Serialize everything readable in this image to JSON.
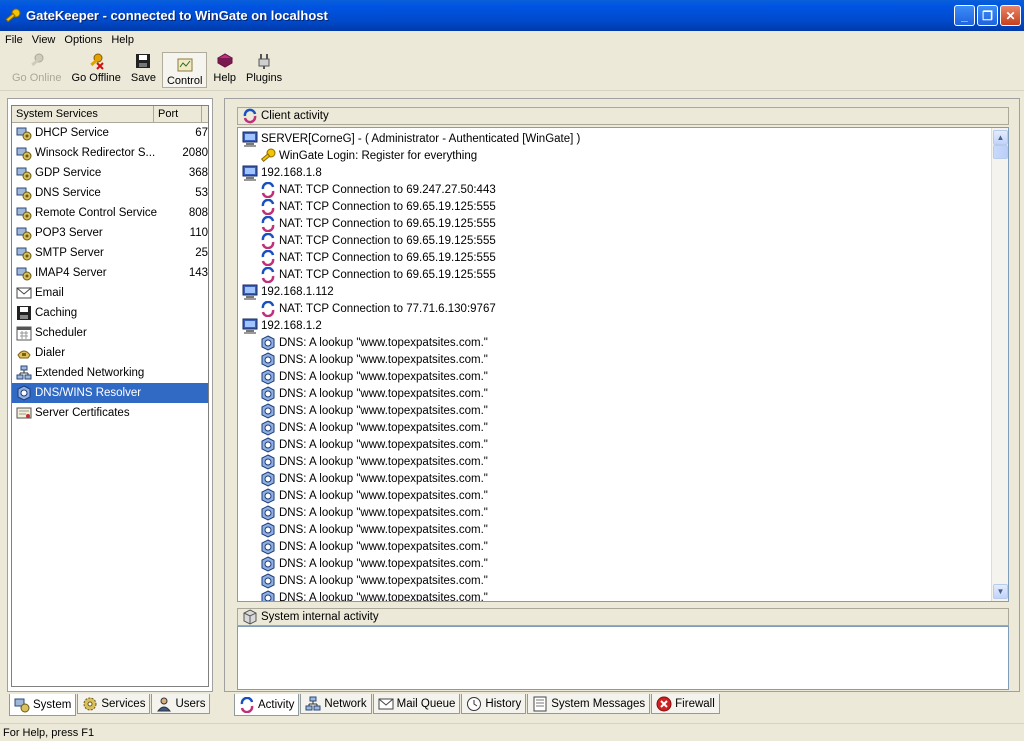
{
  "window": {
    "title": "GateKeeper - connected to WinGate on localhost",
    "minimize": "_",
    "maximize": "❐",
    "close": "✕"
  },
  "menu": [
    "File",
    "View",
    "Options",
    "Help"
  ],
  "toolbar": [
    {
      "label": "Go Online",
      "icon": "key-icon",
      "disabled": true
    },
    {
      "label": "Go Offline",
      "icon": "key-disconnect-icon"
    },
    {
      "label": "Save",
      "icon": "floppy-disk-icon"
    },
    {
      "label": "Control",
      "icon": "control-panel-icon",
      "pressed": true
    },
    {
      "label": "Help",
      "icon": "book-icon"
    },
    {
      "label": "Plugins",
      "icon": "plug-icon"
    }
  ],
  "left_panel": {
    "columns": [
      "System Services",
      "Port"
    ],
    "items": [
      {
        "name": "DHCP Service",
        "port": "67",
        "icon": "service-icon"
      },
      {
        "name": "Winsock Redirector S...",
        "port": "2080",
        "icon": "service-icon"
      },
      {
        "name": "GDP Service",
        "port": "368",
        "icon": "service-icon"
      },
      {
        "name": "DNS Service",
        "port": "53",
        "icon": "service-icon"
      },
      {
        "name": "Remote Control Service",
        "port": "808",
        "icon": "service-icon"
      },
      {
        "name": "POP3 Server",
        "port": "110",
        "icon": "service-icon"
      },
      {
        "name": "SMTP Server",
        "port": "25",
        "icon": "service-icon"
      },
      {
        "name": "IMAP4 Server",
        "port": "143",
        "icon": "service-icon"
      },
      {
        "name": "Email",
        "port": "",
        "icon": "envelope-icon"
      },
      {
        "name": "Caching",
        "port": "",
        "icon": "disk-icon"
      },
      {
        "name": "Scheduler",
        "port": "",
        "icon": "calendar-icon"
      },
      {
        "name": "Dialer",
        "port": "",
        "icon": "phone-icon"
      },
      {
        "name": "Extended Networking",
        "port": "",
        "icon": "network-icon"
      },
      {
        "name": "DNS/WINS Resolver",
        "port": "",
        "icon": "resolver-icon",
        "selected": true
      },
      {
        "name": "Server Certificates",
        "port": "",
        "icon": "certificate-icon"
      }
    ],
    "tabs": [
      {
        "label": "System",
        "icon": "system-icon",
        "active": true
      },
      {
        "label": "Services",
        "icon": "gear-icon"
      },
      {
        "label": "Users",
        "icon": "user-icon"
      }
    ]
  },
  "right_panel": {
    "client_activity_title": "Client activity",
    "rows": [
      {
        "level": 0,
        "icon": "computer-icon",
        "text": "SERVER[CorneG]  -  ( Administrator  -  Authenticated [WinGate] )"
      },
      {
        "level": 1,
        "icon": "key-icon",
        "text": "WinGate Login: Register for everything"
      },
      {
        "level": 0,
        "icon": "computer-icon",
        "text": "192.168.1.8"
      },
      {
        "level": 1,
        "icon": "nat-icon",
        "text": "NAT: TCP Connection to 69.247.27.50:443"
      },
      {
        "level": 1,
        "icon": "nat-icon",
        "text": "NAT: TCP Connection to 69.65.19.125:555"
      },
      {
        "level": 1,
        "icon": "nat-icon",
        "text": "NAT: TCP Connection to 69.65.19.125:555"
      },
      {
        "level": 1,
        "icon": "nat-icon",
        "text": "NAT: TCP Connection to 69.65.19.125:555"
      },
      {
        "level": 1,
        "icon": "nat-icon",
        "text": "NAT: TCP Connection to 69.65.19.125:555"
      },
      {
        "level": 1,
        "icon": "nat-icon",
        "text": "NAT: TCP Connection to 69.65.19.125:555"
      },
      {
        "level": 0,
        "icon": "computer-icon",
        "text": "192.168.1.112"
      },
      {
        "level": 1,
        "icon": "nat-icon",
        "text": "NAT: TCP Connection to 77.71.6.130:9767"
      },
      {
        "level": 0,
        "icon": "computer-icon",
        "text": "192.168.1.2"
      },
      {
        "level": 1,
        "icon": "dns-icon",
        "text": "DNS: A lookup \"www.topexpatsites.com.\""
      },
      {
        "level": 1,
        "icon": "dns-icon",
        "text": "DNS: A lookup \"www.topexpatsites.com.\""
      },
      {
        "level": 1,
        "icon": "dns-icon",
        "text": "DNS: A lookup \"www.topexpatsites.com.\""
      },
      {
        "level": 1,
        "icon": "dns-icon",
        "text": "DNS: A lookup \"www.topexpatsites.com.\""
      },
      {
        "level": 1,
        "icon": "dns-icon",
        "text": "DNS: A lookup \"www.topexpatsites.com.\""
      },
      {
        "level": 1,
        "icon": "dns-icon",
        "text": "DNS: A lookup \"www.topexpatsites.com.\""
      },
      {
        "level": 1,
        "icon": "dns-icon",
        "text": "DNS: A lookup \"www.topexpatsites.com.\""
      },
      {
        "level": 1,
        "icon": "dns-icon",
        "text": "DNS: A lookup \"www.topexpatsites.com.\""
      },
      {
        "level": 1,
        "icon": "dns-icon",
        "text": "DNS: A lookup \"www.topexpatsites.com.\""
      },
      {
        "level": 1,
        "icon": "dns-icon",
        "text": "DNS: A lookup \"www.topexpatsites.com.\""
      },
      {
        "level": 1,
        "icon": "dns-icon",
        "text": "DNS: A lookup \"www.topexpatsites.com.\""
      },
      {
        "level": 1,
        "icon": "dns-icon",
        "text": "DNS: A lookup \"www.topexpatsites.com.\""
      },
      {
        "level": 1,
        "icon": "dns-icon",
        "text": "DNS: A lookup \"www.topexpatsites.com.\""
      },
      {
        "level": 1,
        "icon": "dns-icon",
        "text": "DNS: A lookup \"www.topexpatsites.com.\""
      },
      {
        "level": 1,
        "icon": "dns-icon",
        "text": "DNS: A lookup \"www.topexpatsites.com.\""
      },
      {
        "level": 1,
        "icon": "dns-icon",
        "text": "DNS: A lookup \"www.topexpatsites.com.\""
      }
    ],
    "internal_activity_title": "System internal activity",
    "tabs": [
      {
        "label": "Activity",
        "icon": "activity-icon",
        "active": true
      },
      {
        "label": "Network",
        "icon": "network-icon"
      },
      {
        "label": "Mail Queue",
        "icon": "envelope-icon"
      },
      {
        "label": "History",
        "icon": "clock-icon"
      },
      {
        "label": "System Messages",
        "icon": "document-icon"
      },
      {
        "label": "Firewall",
        "icon": "stop-icon"
      }
    ]
  },
  "status_bar": {
    "text": "For Help, press F1"
  },
  "colors": {
    "title_bar": "#0054e3",
    "selection": "#316ac5",
    "face": "#ece9d8"
  }
}
